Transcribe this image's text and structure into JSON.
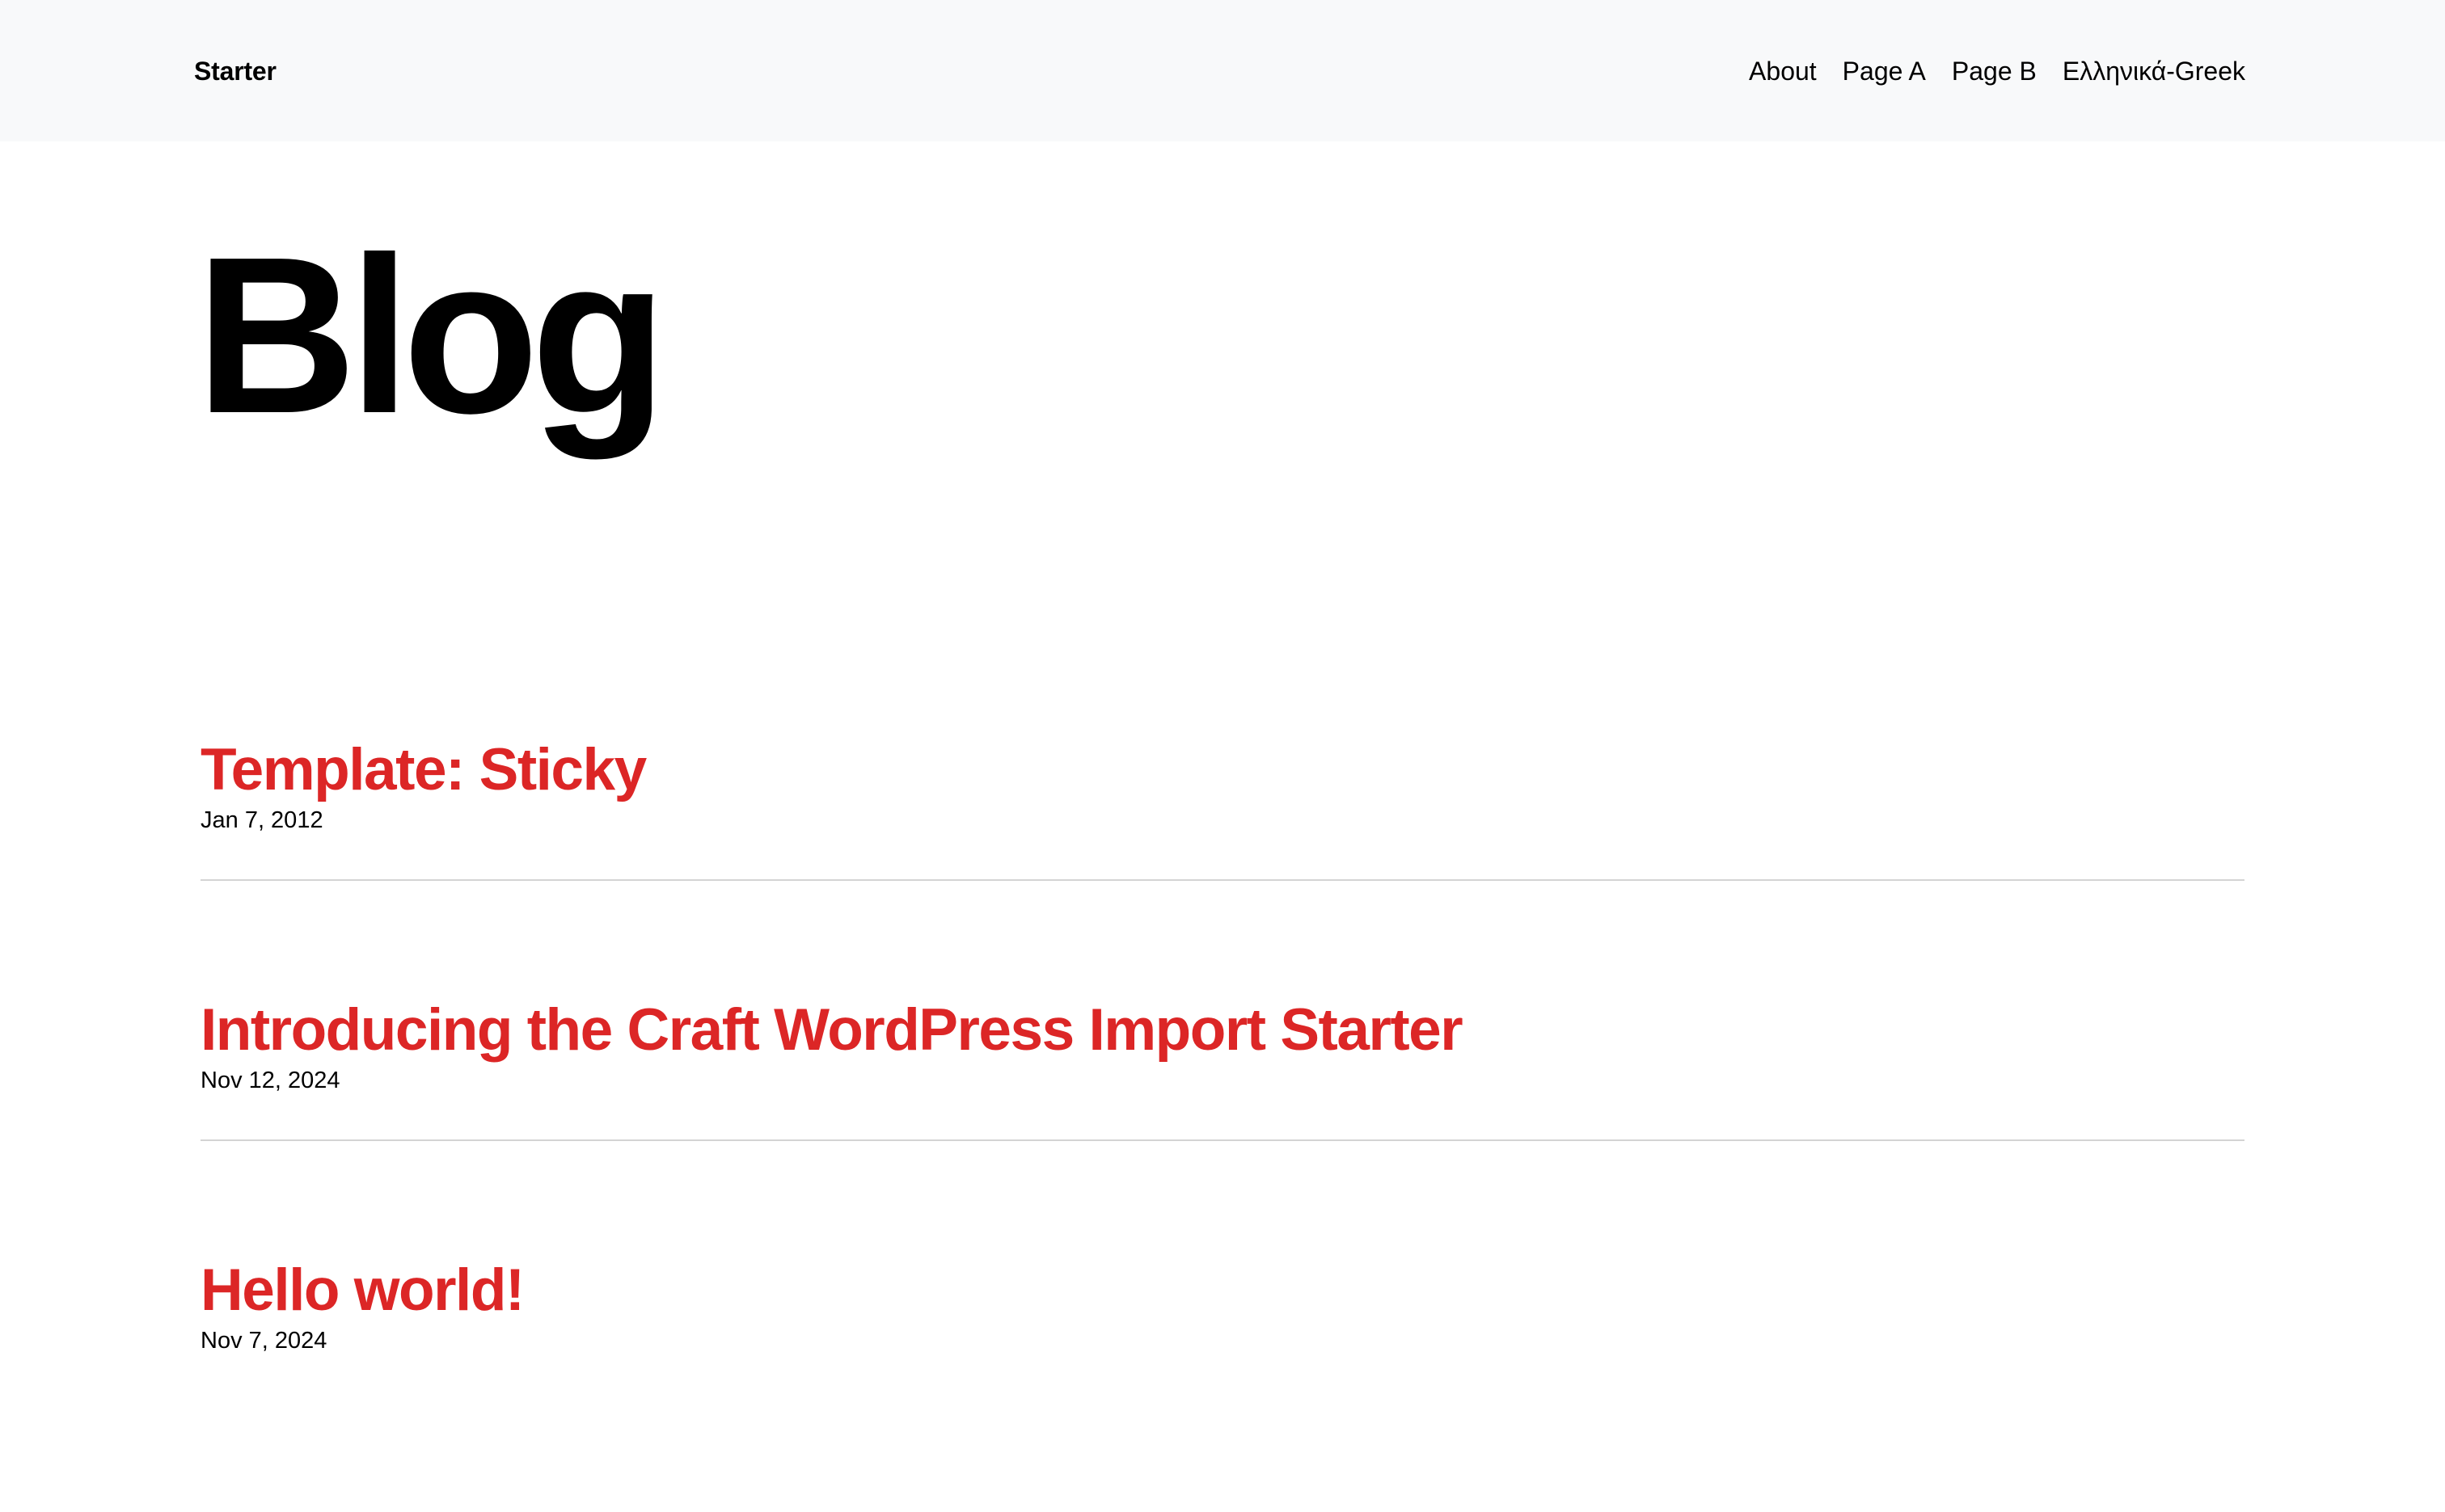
{
  "header": {
    "site_name": "Starter",
    "nav": [
      {
        "label": "About"
      },
      {
        "label": "Page A"
      },
      {
        "label": "Page B"
      },
      {
        "label": "Ελληνικά-Greek"
      }
    ]
  },
  "main": {
    "title": "Blog",
    "posts": [
      {
        "title": "Template: Sticky",
        "date": "Jan 7, 2012"
      },
      {
        "title": "Introducing the Craft WordPress Import Starter",
        "date": "Nov 12, 2024"
      },
      {
        "title": "Hello world!",
        "date": "Nov 7, 2024"
      }
    ]
  },
  "colors": {
    "header_background": "#f8f9fa",
    "post_title": "#dc2626",
    "divider": "#d4d4d4",
    "text": "#000000"
  }
}
